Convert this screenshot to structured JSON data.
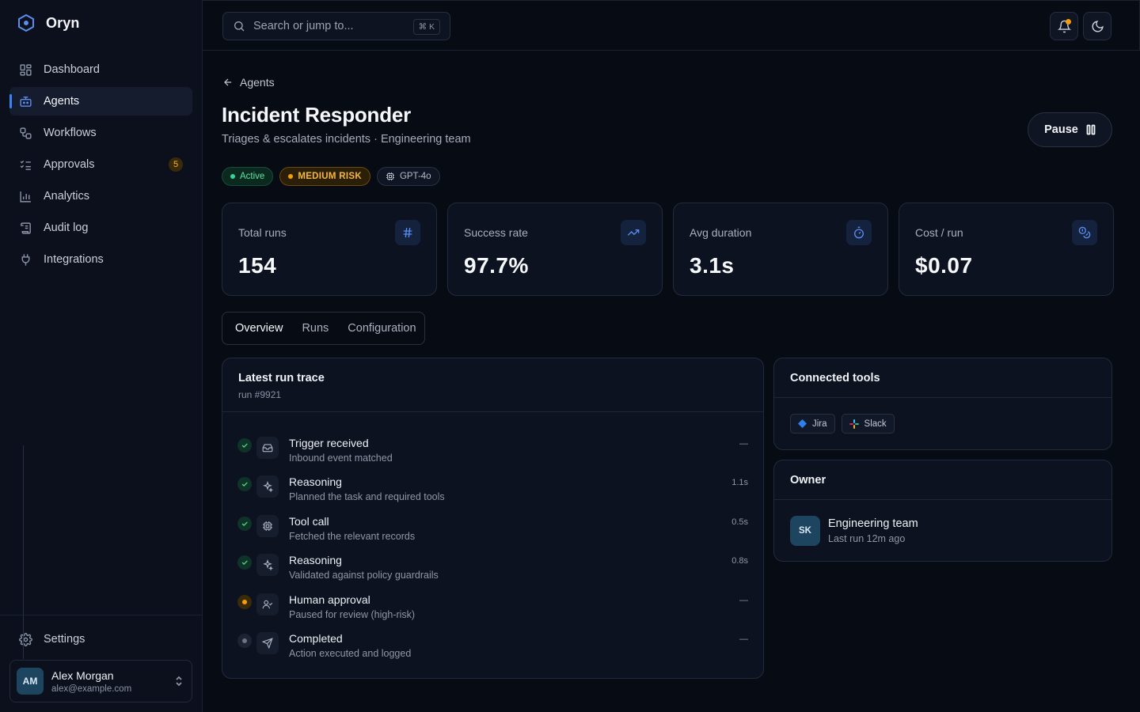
{
  "brand": {
    "name": "Oryn"
  },
  "sidebar": {
    "items": [
      {
        "label": "Dashboard",
        "icon": "dashboard-icon"
      },
      {
        "label": "Agents",
        "icon": "bot-icon",
        "active": true
      },
      {
        "label": "Workflows",
        "icon": "workflow-icon"
      },
      {
        "label": "Approvals",
        "icon": "list-check-icon",
        "badge": "5"
      },
      {
        "label": "Analytics",
        "icon": "bar-chart-icon"
      },
      {
        "label": "Audit log",
        "icon": "scroll-icon"
      },
      {
        "label": "Integrations",
        "icon": "plug-icon"
      }
    ],
    "settings": "Settings",
    "user": {
      "initials": "AM",
      "name": "Alex Morgan",
      "email": "alex@example.com"
    }
  },
  "topbar": {
    "search_placeholder": "Search or jump to...",
    "shortcut": "⌘ K"
  },
  "page": {
    "back_label": "Agents",
    "title": "Incident Responder",
    "subtitle": "Triages & escalates incidents · Engineering team",
    "pause_label": "Pause",
    "pills": {
      "status": "Active",
      "risk": "MEDIUM RISK",
      "model": "GPT-4o"
    }
  },
  "stats": [
    {
      "label": "Total runs",
      "value": "154",
      "icon": "hash-icon"
    },
    {
      "label": "Success rate",
      "value": "97.7%",
      "icon": "trending-up-icon"
    },
    {
      "label": "Avg duration",
      "value": "3.1s",
      "icon": "timer-icon"
    },
    {
      "label": "Cost / run",
      "value": "$0.07",
      "icon": "coins-icon"
    }
  ],
  "tabs": [
    "Overview",
    "Runs",
    "Configuration"
  ],
  "trace": {
    "title": "Latest run trace",
    "run_id": "run #9921",
    "steps": [
      {
        "title": "Trigger received",
        "desc": "Inbound event matched",
        "time": "—",
        "status": "done",
        "icon": "inbox-icon"
      },
      {
        "title": "Reasoning",
        "desc": "Planned the task and required tools",
        "time": "1.1s",
        "status": "done",
        "icon": "sparkles-icon"
      },
      {
        "title": "Tool call",
        "desc": "Fetched the relevant records",
        "time": "0.5s",
        "status": "done",
        "icon": "cpu-icon"
      },
      {
        "title": "Reasoning",
        "desc": "Validated against policy guardrails",
        "time": "0.8s",
        "status": "done",
        "icon": "sparkles-icon"
      },
      {
        "title": "Human approval",
        "desc": "Paused for review (high-risk)",
        "time": "—",
        "status": "pending",
        "icon": "user-check-icon"
      },
      {
        "title": "Completed",
        "desc": "Action executed and logged",
        "time": "—",
        "status": "idle",
        "icon": "send-icon"
      }
    ]
  },
  "tools": {
    "title": "Connected tools",
    "items": [
      "Jira",
      "Slack"
    ]
  },
  "owner": {
    "title": "Owner",
    "initials": "SK",
    "name": "Engineering team",
    "last_run": "Last run 12m ago"
  },
  "colors": {
    "accent": "#3b82f6",
    "success": "#4ade80",
    "warning": "#f59e0b",
    "background": "#070b14"
  }
}
